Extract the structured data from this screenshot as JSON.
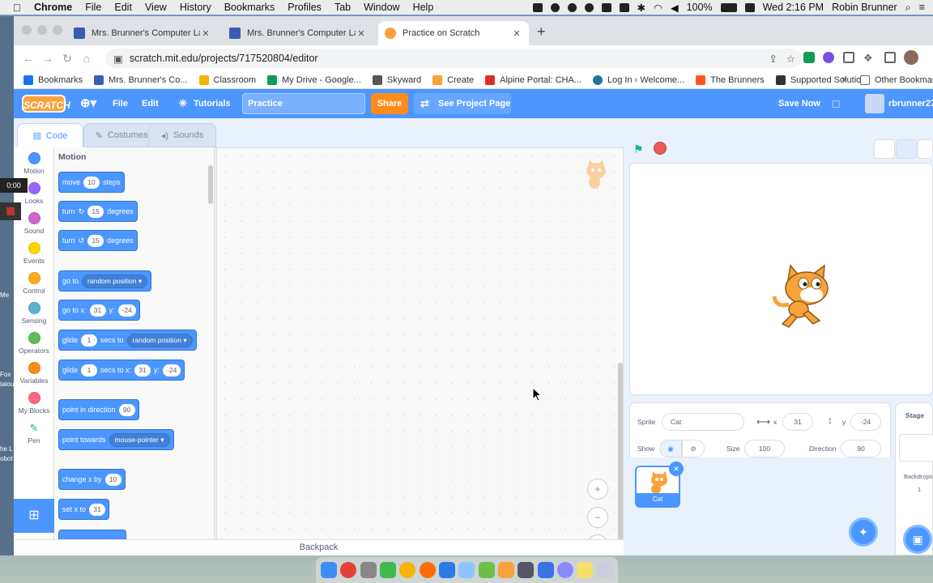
{
  "menubar": {
    "app": "Chrome",
    "items": [
      "File",
      "Edit",
      "View",
      "History",
      "Bookmarks",
      "Profiles",
      "Tab",
      "Window",
      "Help"
    ],
    "battery": "100%",
    "datetime": "Wed 2:16 PM",
    "user": "Robin Brunner"
  },
  "tabs": [
    {
      "title": "Mrs. Brunner's Computer Lab",
      "favicon": "calendar-icon",
      "color": "#3b5bb5"
    },
    {
      "title": "Mrs. Brunner's Computer Lab",
      "favicon": "calendar-icon",
      "color": "#3b5bb5"
    },
    {
      "title": "Practice on Scratch",
      "favicon": "scratch-icon",
      "color": "#f9a23b",
      "active": true
    }
  ],
  "address": {
    "url": "scratch.mit.edu/projects/717520804/editor"
  },
  "bookmarks": [
    {
      "label": "Bookmarks",
      "color": "#1a73e8"
    },
    {
      "label": "Mrs. Brunner's Co...",
      "color": "#3b5bb5"
    },
    {
      "label": "Classroom",
      "color": "#f4b400"
    },
    {
      "label": "My Drive - Google...",
      "color": "#0f9d58"
    },
    {
      "label": "Skyward",
      "color": "#555"
    },
    {
      "label": "Create",
      "color": "#f9a23b"
    },
    {
      "label": "Alpine Portal: CHA...",
      "color": "#d93025"
    },
    {
      "label": "Log In ‹ Welcome...",
      "color": "#21759b"
    },
    {
      "label": "The Brunners",
      "color": "#ff5722"
    },
    {
      "label": "Supported Solutio...",
      "color": "#333"
    }
  ],
  "bookmarks_more": "»",
  "other_bookmarks": "Other Bookmarks",
  "scratch": {
    "logo": "SCRATCH",
    "file": "File",
    "edit": "Edit",
    "tutorials": "Tutorials",
    "project_name": "Practice",
    "share": "Share",
    "see_project": "See Project Page",
    "save_now": "Save Now",
    "username": "rbrunner27",
    "editor_tabs": {
      "code": "Code",
      "costumes": "Costumes",
      "sounds": "Sounds"
    },
    "categories": [
      {
        "label": "Motion",
        "color": "#4c97ff"
      },
      {
        "label": "Looks",
        "color": "#9966ff"
      },
      {
        "label": "Sound",
        "color": "#cf63cf"
      },
      {
        "label": "Events",
        "color": "#ffd500"
      },
      {
        "label": "Control",
        "color": "#ffab19"
      },
      {
        "label": "Sensing",
        "color": "#5cb1d6"
      },
      {
        "label": "Operators",
        "color": "#59c059"
      },
      {
        "label": "Variables",
        "color": "#ff8c1a"
      },
      {
        "label": "My Blocks",
        "color": "#ff6680"
      },
      {
        "label": "Pen",
        "color": "#0fbd8c"
      }
    ],
    "palette_title": "Motion",
    "blocks": {
      "move": {
        "a": "move",
        "v": "10",
        "b": "steps"
      },
      "turn_cw": {
        "a": "turn",
        "v": "15",
        "b": "degrees"
      },
      "turn_ccw": {
        "a": "turn",
        "v": "15",
        "b": "degrees"
      },
      "goto": {
        "a": "go to",
        "dd": "random position"
      },
      "gotoxy": {
        "a": "go to x:",
        "x": "31",
        "b": "y:",
        "y": "-24"
      },
      "glide_to": {
        "a": "glide",
        "v": "1",
        "b": "secs to",
        "dd": "random position"
      },
      "glide_xy": {
        "a": "glide",
        "v": "1",
        "b": "secs to x:",
        "x": "31",
        "c": "y:",
        "y": "-24"
      },
      "point_dir": {
        "a": "point in direction",
        "v": "90"
      },
      "point_towards": {
        "a": "point towards",
        "dd": "mouse-pointer"
      },
      "change_x": {
        "a": "change x by",
        "v": "10"
      },
      "set_x": {
        "a": "set x to",
        "v": "31"
      }
    },
    "backpack": "Backpack",
    "sprite_info": {
      "sprite_label": "Sprite",
      "sprite_name": "Cat",
      "x_label": "x",
      "x": "31",
      "y_label": "y",
      "y": "-24",
      "show_label": "Show",
      "size_label": "Size",
      "size": "100",
      "direction_label": "Direction",
      "direction": "90"
    },
    "sprites": [
      {
        "name": "Cat"
      }
    ],
    "stage_panel": {
      "title": "Stage",
      "backdrops_label": "Backdrops",
      "backdrops_count": "1"
    }
  },
  "overlay": {
    "timer": "0:00",
    "side_texts": [
      "Me",
      "Fox",
      "talou",
      "he L",
      "obot"
    ]
  }
}
